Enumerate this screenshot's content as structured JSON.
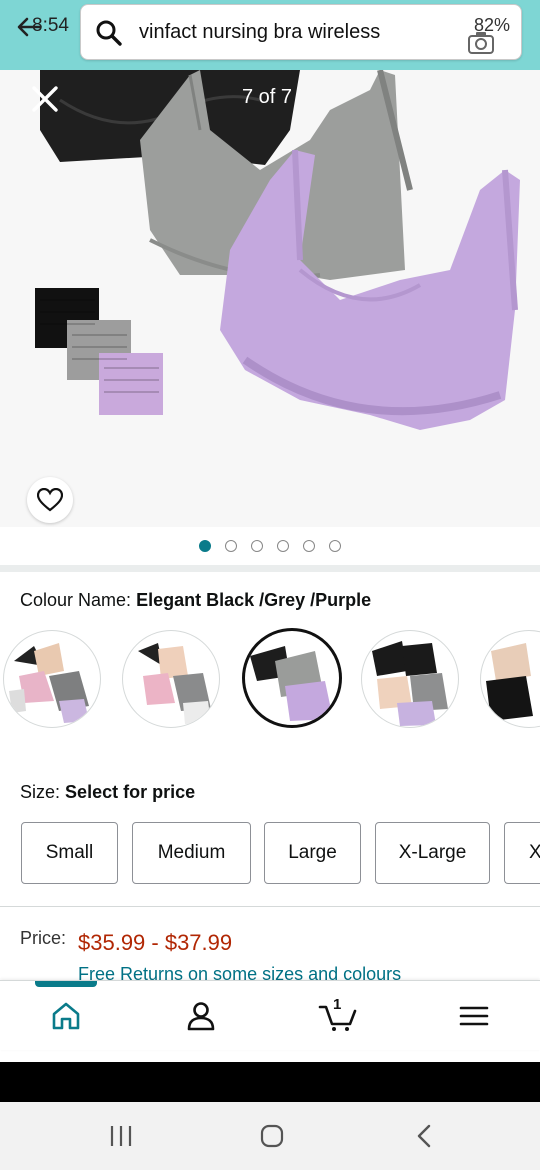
{
  "status": {
    "time": "8:54",
    "battery": "82%"
  },
  "search": {
    "query": "vinfact nursing bra wireless"
  },
  "gallery": {
    "counter": "7 of 7",
    "dots_total": 6,
    "active_dot": 1
  },
  "product": {
    "colour_label": "Colour Name:",
    "colour_value": "Elegant Black /Grey /Purple",
    "size_label": "Size:",
    "size_value": "Select for price",
    "sizes": [
      "Small",
      "Medium",
      "Large",
      "X-Large",
      "X"
    ],
    "price_label": "Price:",
    "price_value": "$35.99 - $37.99",
    "returns_text": "Free Returns on some sizes and colours"
  },
  "tabbar": {
    "cart_count": "1"
  },
  "colors": {
    "teal": "#7ed6d4",
    "accent": "#0a7b8a",
    "price": "#b12704",
    "link": "#007185"
  },
  "icons": [
    "back-arrow-icon",
    "search-icon",
    "camera-icon",
    "close-icon",
    "heart-icon",
    "home-icon",
    "account-icon",
    "cart-icon",
    "menu-icon",
    "recents-icon",
    "home-nav-icon",
    "back-nav-icon"
  ]
}
